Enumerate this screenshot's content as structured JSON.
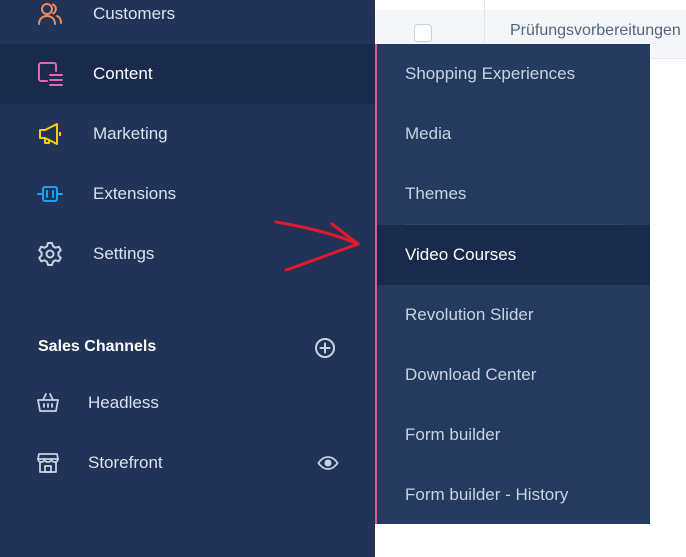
{
  "sidebar": {
    "items": [
      {
        "label": "Customers",
        "icon": "customers-icon",
        "icon_color": "#f08a5d",
        "active": false
      },
      {
        "label": "Content",
        "icon": "content-icon",
        "icon_color": "#e066b8",
        "active": true
      },
      {
        "label": "Marketing",
        "icon": "megaphone-icon",
        "icon_color": "#f5d000",
        "active": false
      },
      {
        "label": "Extensions",
        "icon": "plug-icon",
        "icon_color": "#1ea0f2",
        "active": false
      },
      {
        "label": "Settings",
        "icon": "gear-icon",
        "icon_color": "#c8d3e3",
        "active": false
      }
    ],
    "sales_channels": {
      "title": "Sales Channels",
      "add_icon": "add-circle-icon",
      "items": [
        {
          "label": "Headless",
          "icon": "basket-icon"
        },
        {
          "label": "Storefront",
          "icon": "storefront-icon",
          "visibility_icon": "eye-icon"
        }
      ]
    }
  },
  "submenu": {
    "items": [
      {
        "label": "Shopping Experiences",
        "active": false
      },
      {
        "label": "Media",
        "active": false
      },
      {
        "label": "Themes",
        "active": false
      },
      {
        "label": "Video Courses",
        "active": true
      },
      {
        "label": "Revolution Slider",
        "active": false
      },
      {
        "label": "Download Center",
        "active": false
      },
      {
        "label": "Form builder",
        "active": false
      },
      {
        "label": "Form builder - History",
        "active": false
      }
    ],
    "accent_color": "#e0568f"
  },
  "background_table": {
    "row_text": "Prüfungsvorbereitungen"
  },
  "annotation": {
    "arrow_color": "#e8182c"
  },
  "colors": {
    "sidebar_bg": "#213356",
    "active_bg": "#1a2a4c",
    "flyout_bg": "#243a5e"
  }
}
